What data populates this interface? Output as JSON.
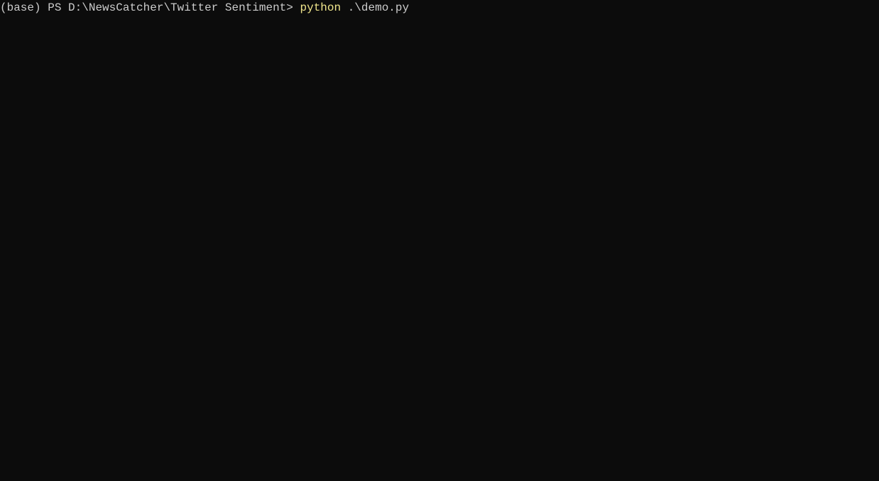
{
  "terminal": {
    "prompt_env": "(base) ",
    "prompt_shell": "PS ",
    "prompt_path": "D:\\NewsCatcher\\Twitter Sentiment> ",
    "command": "python",
    "command_args": " .\\demo.py"
  }
}
